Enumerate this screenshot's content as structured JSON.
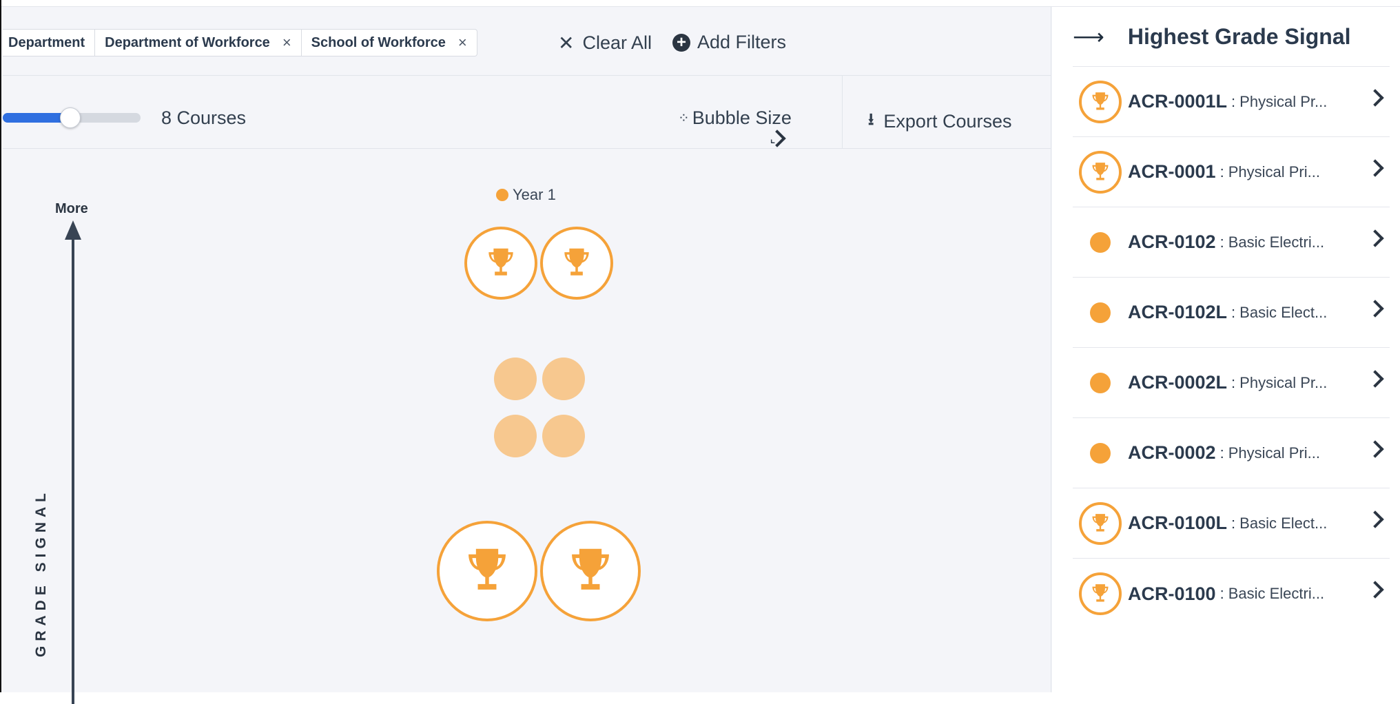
{
  "filters": {
    "chips": [
      {
        "label": "Department",
        "removable": false
      },
      {
        "label": "Department of Workforce",
        "removable": true,
        "remove_icon": "×"
      },
      {
        "label": "School of Workforce",
        "removable": true,
        "remove_icon": "×"
      }
    ],
    "clear_all_icon": "✕",
    "clear_all_label": "Clear All",
    "add_filters_icon": "+",
    "add_filters_label": "Add Filters"
  },
  "toolbar": {
    "slider_fill_fraction": 0.49,
    "course_count_label": "8 Courses",
    "bubble_size_icon": "⁘",
    "bubble_size_label": "Bubble Size",
    "bubble_size_chevron": "⌄",
    "export_icon": "⭳",
    "export_label": "Export Courses"
  },
  "chart": {
    "legend_label": "Year 1",
    "legend_color": "#f5a239",
    "axis_top_label": "More",
    "axis_label": "GRADE SIGNAL",
    "accent_color": "#f5a239",
    "soft_color": "#f7c88f",
    "bubble_icon": "trophy-icon"
  },
  "panel": {
    "header_icon": "⟶",
    "title": "Highest Grade Signal",
    "items": [
      {
        "code": "ACR-0001L",
        "sep": ":",
        "desc": "Physical Pr...",
        "icon": "trophy"
      },
      {
        "code": "ACR-0001",
        "sep": ":",
        "desc": "Physical Pri...",
        "icon": "trophy"
      },
      {
        "code": "ACR-0102",
        "sep": ":",
        "desc": "Basic Electri...",
        "icon": "dot"
      },
      {
        "code": "ACR-0102L",
        "sep": ":",
        "desc": "Basic Elect...",
        "icon": "dot"
      },
      {
        "code": "ACR-0002L",
        "sep": ":",
        "desc": "Physical Pr...",
        "icon": "dot"
      },
      {
        "code": "ACR-0002",
        "sep": ":",
        "desc": "Physical Pri...",
        "icon": "dot"
      },
      {
        "code": "ACR-0100L",
        "sep": ":",
        "desc": "Basic Elect...",
        "icon": "trophy"
      },
      {
        "code": "ACR-0100",
        "sep": ":",
        "desc": "Basic Electri...",
        "icon": "trophy"
      }
    ]
  }
}
